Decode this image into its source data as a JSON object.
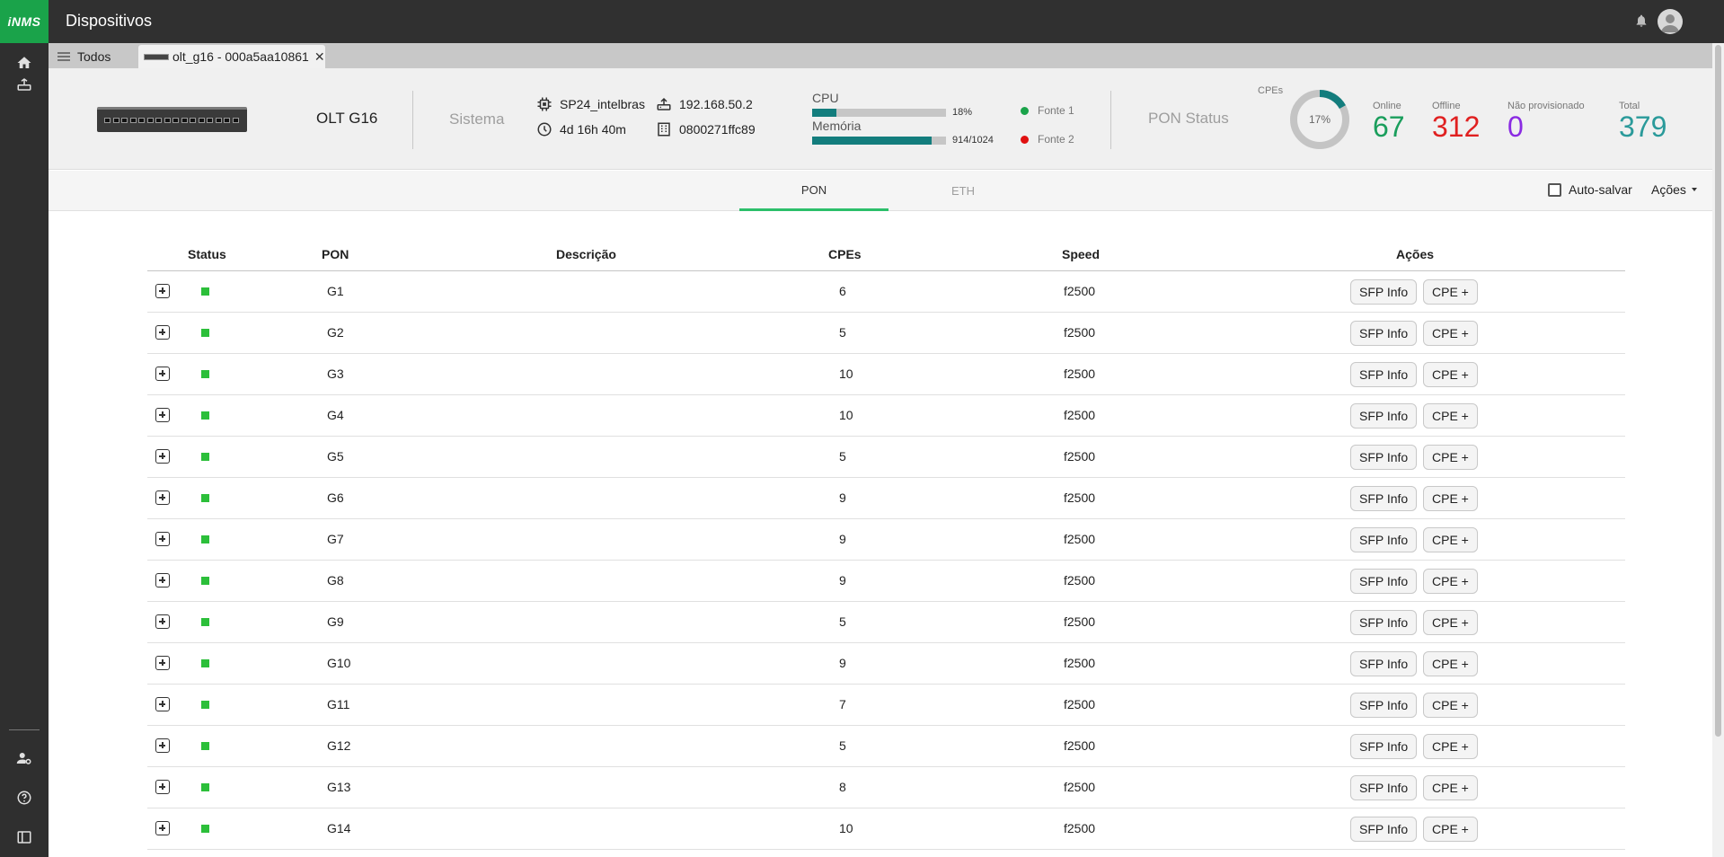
{
  "app": {
    "logo": "iNMS",
    "title": "Dispositivos"
  },
  "tabs": {
    "all_label": "Todos",
    "device_label": "olt_g16 - 000a5aa10861",
    "close_glyph": "✕"
  },
  "device": {
    "name": "OLT G16",
    "system_label": "Sistema",
    "firmware": "SP24_intelbras",
    "ip": "192.168.50.2",
    "uptime": "4d 16h 40m",
    "serial": "0800271ffc89",
    "cpu_label": "CPU",
    "cpu_percent": 18,
    "cpu_value": "18%",
    "memory_label": "Memória",
    "memory_used": 914,
    "memory_total": 1024,
    "memory_value": "914/1024",
    "power1_label": "Fonte 1",
    "power1_color": "#1aa34a",
    "power2_label": "Fonte 2",
    "power2_color": "#e01010",
    "pon_status_label": "PON Status",
    "cpes_label": "CPEs",
    "cpe_online_percent": 17,
    "cpe_percent_text": "17%",
    "stats": {
      "online_label": "Online",
      "online": "67",
      "online_color": "#1a9e5c",
      "offline_label": "Offline",
      "offline": "312",
      "offline_color": "#e02020",
      "unprov_label": "Não provisionado",
      "unprov": "0",
      "unprov_color": "#8a2be2",
      "total_label": "Total",
      "total": "379",
      "total_color": "#2a9a9a"
    }
  },
  "subtabs": {
    "pon": "PON",
    "eth": "ETH",
    "autosave": "Auto-salvar",
    "actions": "Ações"
  },
  "table": {
    "headers": {
      "status": "Status",
      "pon": "PON",
      "description": "Descrição",
      "cpes": "CPEs",
      "speed": "Speed",
      "actions": "Ações"
    },
    "sfp_label": "SFP Info",
    "cpe_label": "CPE +",
    "rows": [
      {
        "pon": "G1",
        "description": "",
        "cpes": "6",
        "speed": "f2500"
      },
      {
        "pon": "G2",
        "description": "",
        "cpes": "5",
        "speed": "f2500"
      },
      {
        "pon": "G3",
        "description": "",
        "cpes": "10",
        "speed": "f2500"
      },
      {
        "pon": "G4",
        "description": "",
        "cpes": "10",
        "speed": "f2500"
      },
      {
        "pon": "G5",
        "description": "",
        "cpes": "5",
        "speed": "f2500"
      },
      {
        "pon": "G6",
        "description": "",
        "cpes": "9",
        "speed": "f2500"
      },
      {
        "pon": "G7",
        "description": "",
        "cpes": "9",
        "speed": "f2500"
      },
      {
        "pon": "G8",
        "description": "",
        "cpes": "9",
        "speed": "f2500"
      },
      {
        "pon": "G9",
        "description": "",
        "cpes": "5",
        "speed": "f2500"
      },
      {
        "pon": "G10",
        "description": "",
        "cpes": "9",
        "speed": "f2500"
      },
      {
        "pon": "G11",
        "description": "",
        "cpes": "7",
        "speed": "f2500"
      },
      {
        "pon": "G12",
        "description": "",
        "cpes": "5",
        "speed": "f2500"
      },
      {
        "pon": "G13",
        "description": "",
        "cpes": "8",
        "speed": "f2500"
      },
      {
        "pon": "G14",
        "description": "",
        "cpes": "10",
        "speed": "f2500"
      }
    ]
  }
}
